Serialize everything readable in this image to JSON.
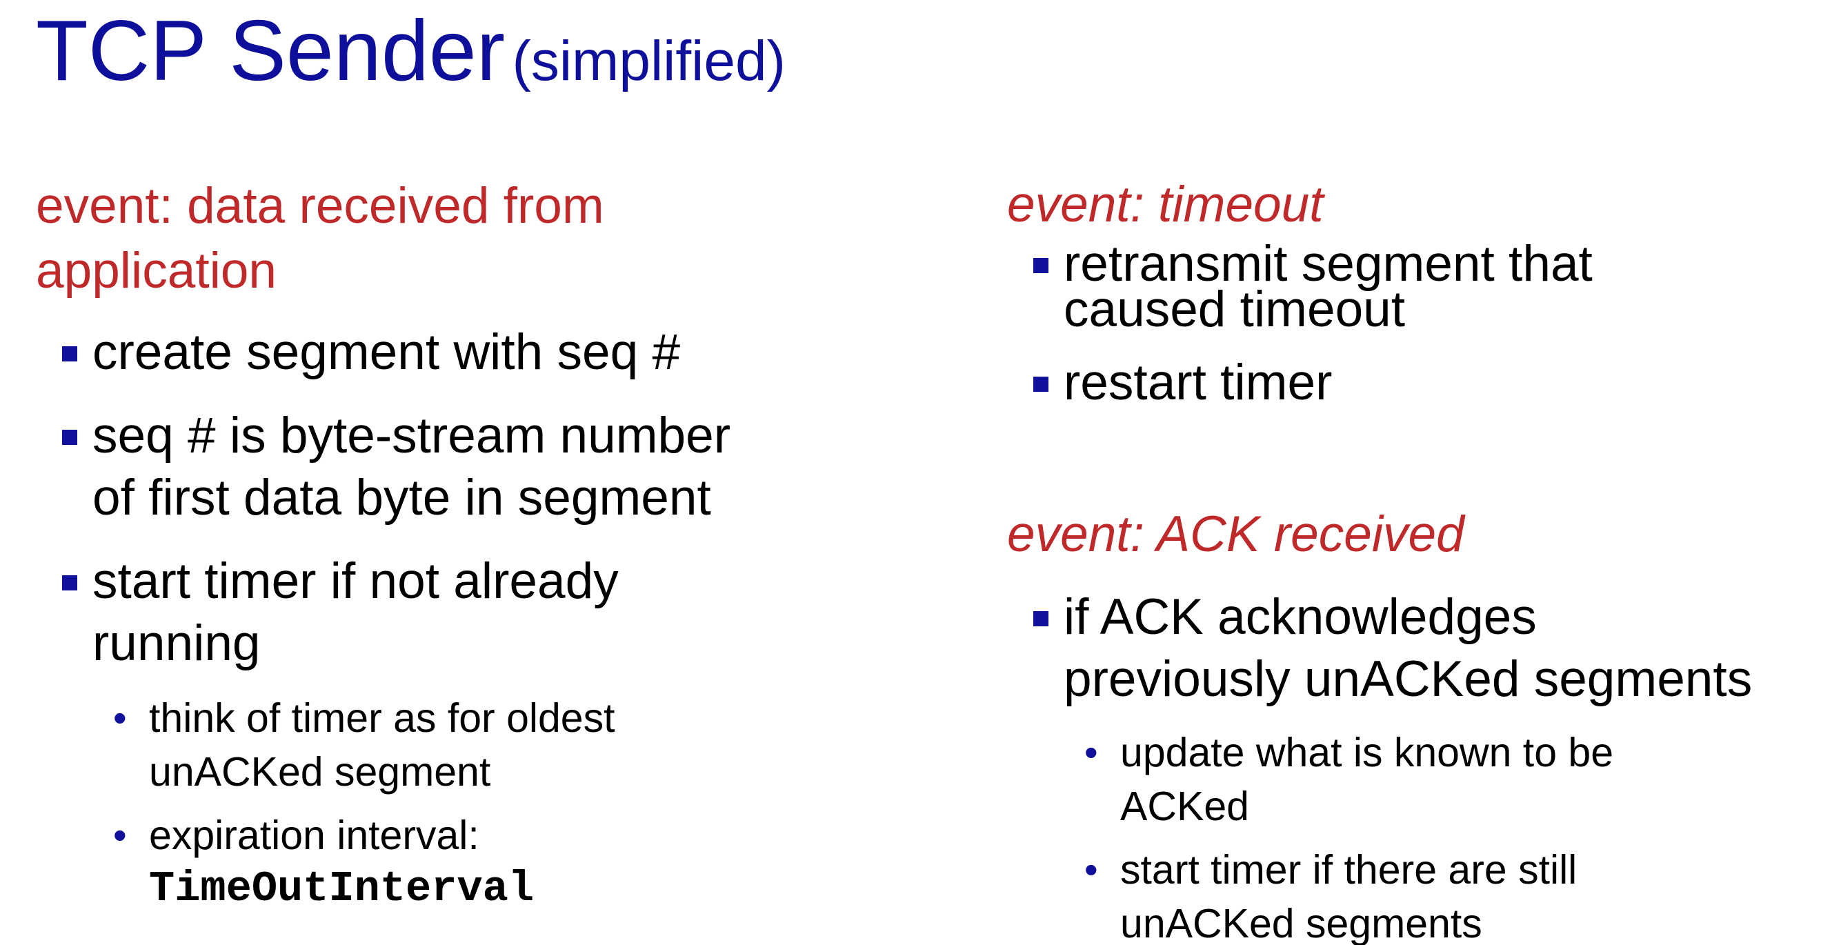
{
  "title": {
    "main": "TCP Sender",
    "sub": "(simplified)"
  },
  "left": {
    "event_line1": "event: data received from",
    "event_line2": "application",
    "bullets": [
      {
        "lines": [
          "create segment with seq #"
        ]
      },
      {
        "lines": [
          "seq # is byte-stream number",
          "of first data byte in  segment"
        ]
      },
      {
        "lines": [
          "start timer if not already",
          "running"
        ]
      }
    ],
    "sub_bullets": [
      {
        "lines": [
          "think of timer as for oldest",
          "unACKed segment"
        ]
      },
      {
        "line1": "expiration interval:",
        "code": "TimeOutInterval"
      }
    ]
  },
  "right": {
    "timeout_event": "event: timeout",
    "timeout_bullets": [
      {
        "lines": [
          "retransmit segment that",
          "caused timeout"
        ]
      },
      {
        "lines": [
          "restart timer"
        ]
      }
    ],
    "ack_event": "event: ACK received",
    "ack_bullets": [
      {
        "lines": [
          "if ACK acknowledges",
          "previously unACKed segments"
        ]
      }
    ],
    "ack_sub_bullets": [
      {
        "lines": [
          "update what is known to be",
          "ACKed"
        ]
      },
      {
        "lines": [
          "start timer if there are  still",
          "unACKed segments"
        ]
      }
    ]
  },
  "colors": {
    "title": "#0e0f9a",
    "event": "#c0292a",
    "bullet_marker": "#10109c",
    "text": "#000000"
  }
}
